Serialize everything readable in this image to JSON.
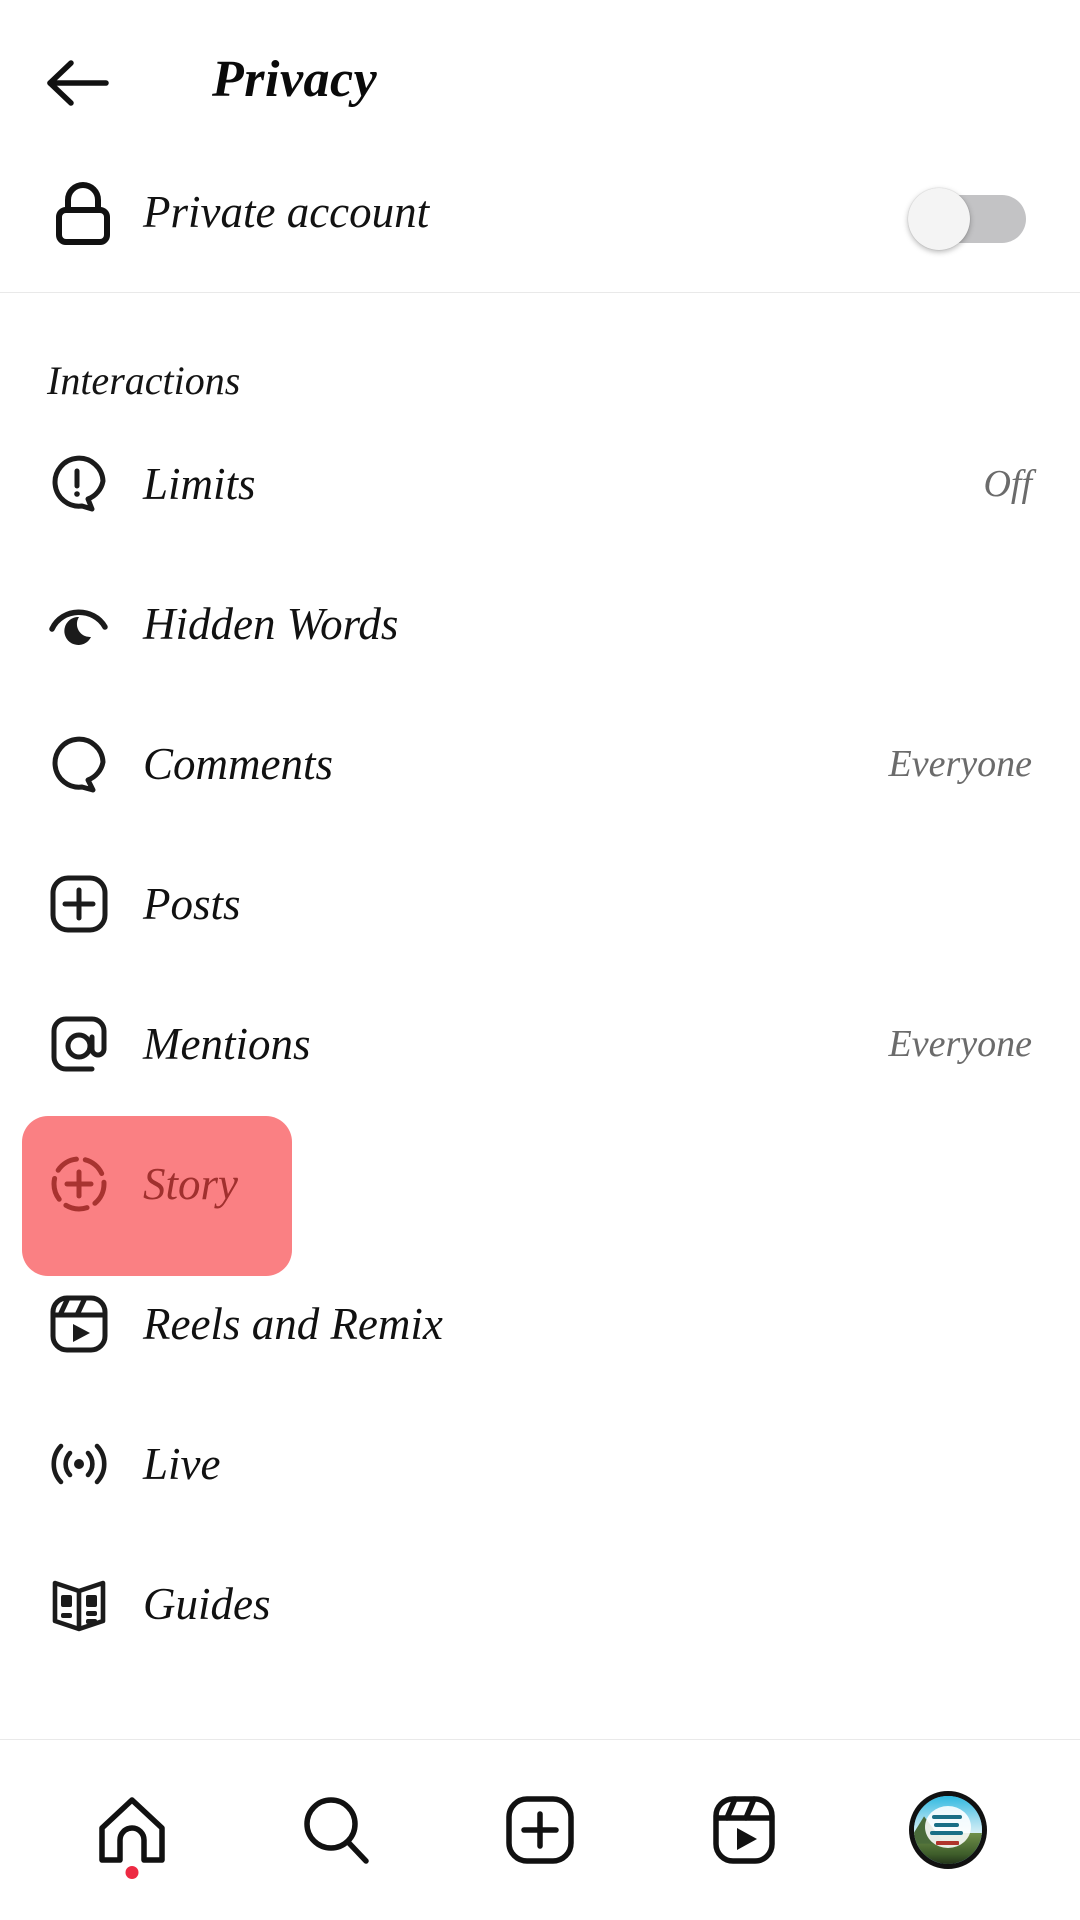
{
  "header": {
    "back_icon": "arrow-left-icon",
    "title": "Privacy"
  },
  "private_account": {
    "icon": "lock-icon",
    "label": "Private account",
    "toggle_state": "off"
  },
  "sections": [
    {
      "title": "Interactions",
      "items": [
        {
          "icon": "limits-icon",
          "label": "Limits",
          "value": "Off"
        },
        {
          "icon": "eye-icon",
          "label": "Hidden Words",
          "value": ""
        },
        {
          "icon": "comment-icon",
          "label": "Comments",
          "value": "Everyone"
        },
        {
          "icon": "posts-icon",
          "label": "Posts",
          "value": ""
        },
        {
          "icon": "mentions-icon",
          "label": "Mentions",
          "value": "Everyone"
        },
        {
          "icon": "story-icon",
          "label": "Story",
          "value": "",
          "highlighted": true
        },
        {
          "icon": "reels-icon",
          "label": "Reels and Remix",
          "value": ""
        },
        {
          "icon": "live-icon",
          "label": "Live",
          "value": ""
        },
        {
          "icon": "guides-icon",
          "label": "Guides",
          "value": ""
        }
      ]
    }
  ],
  "bottom_nav": [
    {
      "icon": "home-icon",
      "label": "Home",
      "badge": true
    },
    {
      "icon": "search-icon",
      "label": "Search",
      "badge": false
    },
    {
      "icon": "create-icon",
      "label": "Create",
      "badge": false
    },
    {
      "icon": "reels-nav-icon",
      "label": "Reels",
      "badge": false
    },
    {
      "icon": "profile-avatar",
      "label": "Profile",
      "badge": false
    }
  ],
  "colors": {
    "highlight": "#FA8083",
    "highlight_text": "#A0302E",
    "toggle_track_off": "#C3C3C5",
    "badge_red": "#ED2A43",
    "value_grey": "#6B6B6B"
  }
}
